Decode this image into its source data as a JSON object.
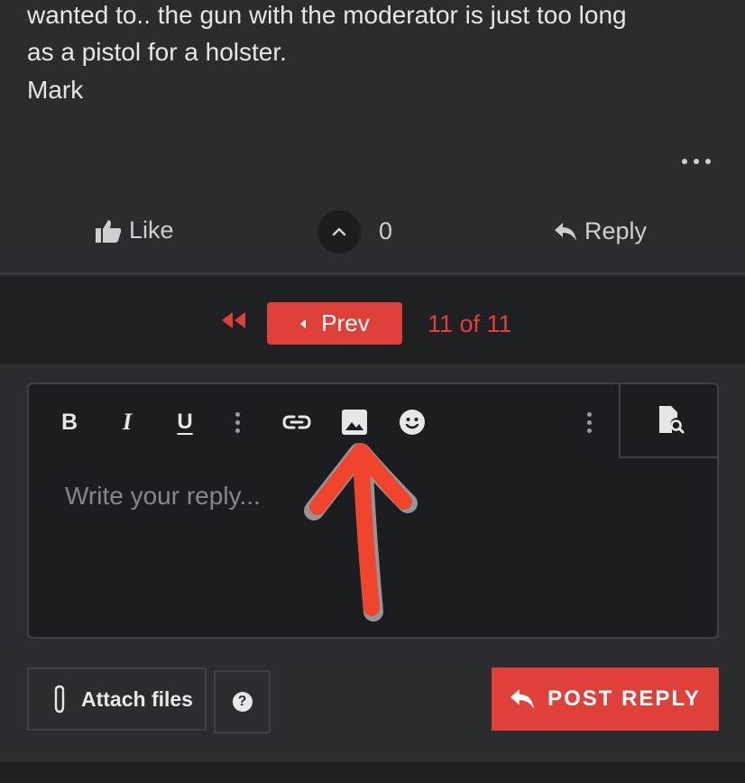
{
  "post": {
    "lines": [
      "wanted to.. the gun with the moderator is just too long",
      "as a pistol for a holster.",
      "Mark"
    ],
    "more_icon": "ellipsis-icon"
  },
  "actions": {
    "like_label": "Like",
    "like_icon": "thumbs-up-icon",
    "vote_icon": "chevron-up-icon",
    "vote_count": "0",
    "reply_label": "Reply",
    "reply_icon": "reply-arrow-icon"
  },
  "pagination": {
    "first_icon": "double-chevron-left-icon",
    "prev_label": "Prev",
    "page_info": "11 of 11"
  },
  "editor": {
    "toolbar": {
      "bold": "B",
      "italic": "I",
      "underline": "U",
      "more_icon": "vertical-ellipsis-icon",
      "link_icon": "link-icon",
      "image_icon": "image-icon",
      "emoji_icon": "smiley-icon",
      "preview_icon": "document-search-icon"
    },
    "placeholder": "Write your reply..."
  },
  "footer": {
    "attach_label": "Attach files",
    "attach_icon": "paperclip-icon",
    "help_icon": "question-circle-icon",
    "help_glyph": "?",
    "post_reply_label": "POST REPLY"
  },
  "colors": {
    "accent": "#e0403a",
    "background": "#2b2c30",
    "editor_background": "#1c1d20"
  }
}
